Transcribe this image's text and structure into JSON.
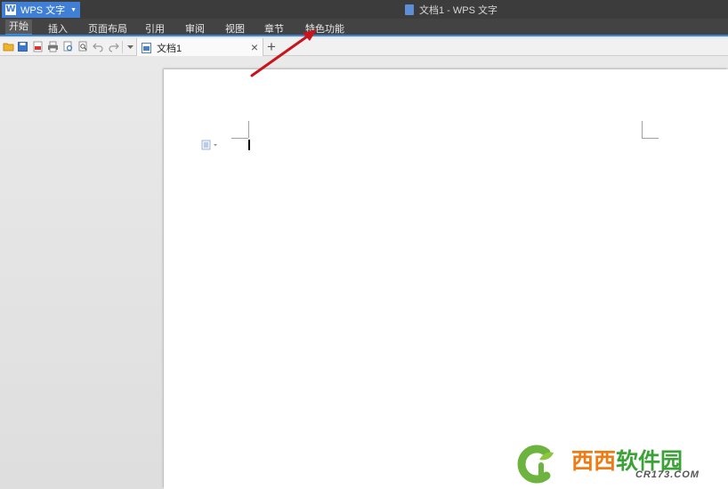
{
  "app": {
    "button_label": "WPS 文字",
    "logo_letter": "W",
    "window_title": "文档1 - WPS 文字"
  },
  "ribbon": {
    "tabs": [
      {
        "label": "开始",
        "active": true
      },
      {
        "label": "插入"
      },
      {
        "label": "页面布局"
      },
      {
        "label": "引用"
      },
      {
        "label": "审阅"
      },
      {
        "label": "视图"
      },
      {
        "label": "章节"
      },
      {
        "label": "特色功能"
      }
    ]
  },
  "toolbar": {
    "icons": [
      "open-icon",
      "save-icon",
      "export-pdf-icon",
      "print-icon",
      "print-preview-icon",
      "find-icon",
      "undo-icon",
      "redo-icon",
      "customize-dropdown-icon"
    ]
  },
  "document_tab": {
    "label": "文档1",
    "close_glyph": "×",
    "new_tab_glyph": "+"
  },
  "watermark": {
    "name_part1": "西西",
    "name_part2": "软件园",
    "domain": "CR173.COM"
  },
  "colors": {
    "accent": "#3b86d8",
    "title_bar": "#3c3c3c",
    "annotation_arrow": "#c8141a"
  }
}
